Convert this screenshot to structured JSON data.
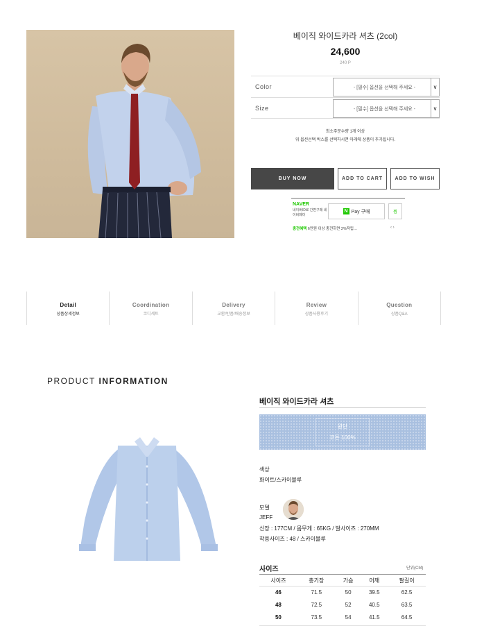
{
  "product": {
    "title": "베이직 와이드카라 셔츠 (2col)",
    "price": "24,600",
    "points": "240 P",
    "options": [
      {
        "label": "Color",
        "value": "- [필수] 옵션을 선택해 주세요 -"
      },
      {
        "label": "Size",
        "value": "- [필수] 옵션을 선택해 주세요 -"
      }
    ],
    "notice_line1": "최소주문수량 1개 이상",
    "notice_line2": "위 옵션선택 박스를 선택하시면 아래에 상품이 추가됩니다.",
    "buttons": {
      "buy": "BUY NOW",
      "cart": "ADD TO CART",
      "wish": "ADD TO WISH"
    }
  },
  "npay": {
    "brand": "NAVER",
    "sub": "네이버ID로 간편구매 네이버페이",
    "pay_n": "N",
    "pay_label": "Pay 구매",
    "zzim": "찜",
    "promo_bold": "충전혜택",
    "promo_text": "6만원 이상 충전하면 2%적립…",
    "pager": "‹ ›"
  },
  "tabs": [
    {
      "en": "Detail",
      "ko": "상품상세정보",
      "active": true
    },
    {
      "en": "Coordination",
      "ko": "코디세트",
      "active": false
    },
    {
      "en": "Delivery",
      "ko": "교환/반품/배송정보",
      "active": false
    },
    {
      "en": "Review",
      "ko": "상품사용후기",
      "active": false
    },
    {
      "en": "Question",
      "ko": "상품Q&A",
      "active": false
    }
  ],
  "info": {
    "heading_light": "PRODUCT",
    "heading_bold": "INFORMATION",
    "name": "베이직 와이드카라 셔츠",
    "fabric_label": "원단",
    "fabric_value": "코튼 100%",
    "color_label": "색상",
    "color_value": "화이트/스카이블루",
    "model_label": "모델",
    "model_name": "JEFF",
    "model_spec": "신장 : 177CM / 몸무게 : 65KG / 발사이즈 : 270MM",
    "model_size": "착용사이즈 : 48 / 스카이블루"
  },
  "size_table": {
    "title": "사이즈",
    "unit": "단위(CM)",
    "headers": [
      "사이즈",
      "총기장",
      "가슴",
      "어깨",
      "팔길이"
    ],
    "rows": [
      [
        "46",
        "71.5",
        "50",
        "39.5",
        "62.5"
      ],
      [
        "48",
        "72.5",
        "52",
        "40.5",
        "63.5"
      ],
      [
        "50",
        "73.5",
        "54",
        "41.5",
        "64.5"
      ]
    ]
  },
  "colors": {
    "buy_bg": "#474747",
    "npay_green": "#1ec800",
    "fabric_blue": "#a9c0e0",
    "shirt_blue": "#b9cdea"
  }
}
